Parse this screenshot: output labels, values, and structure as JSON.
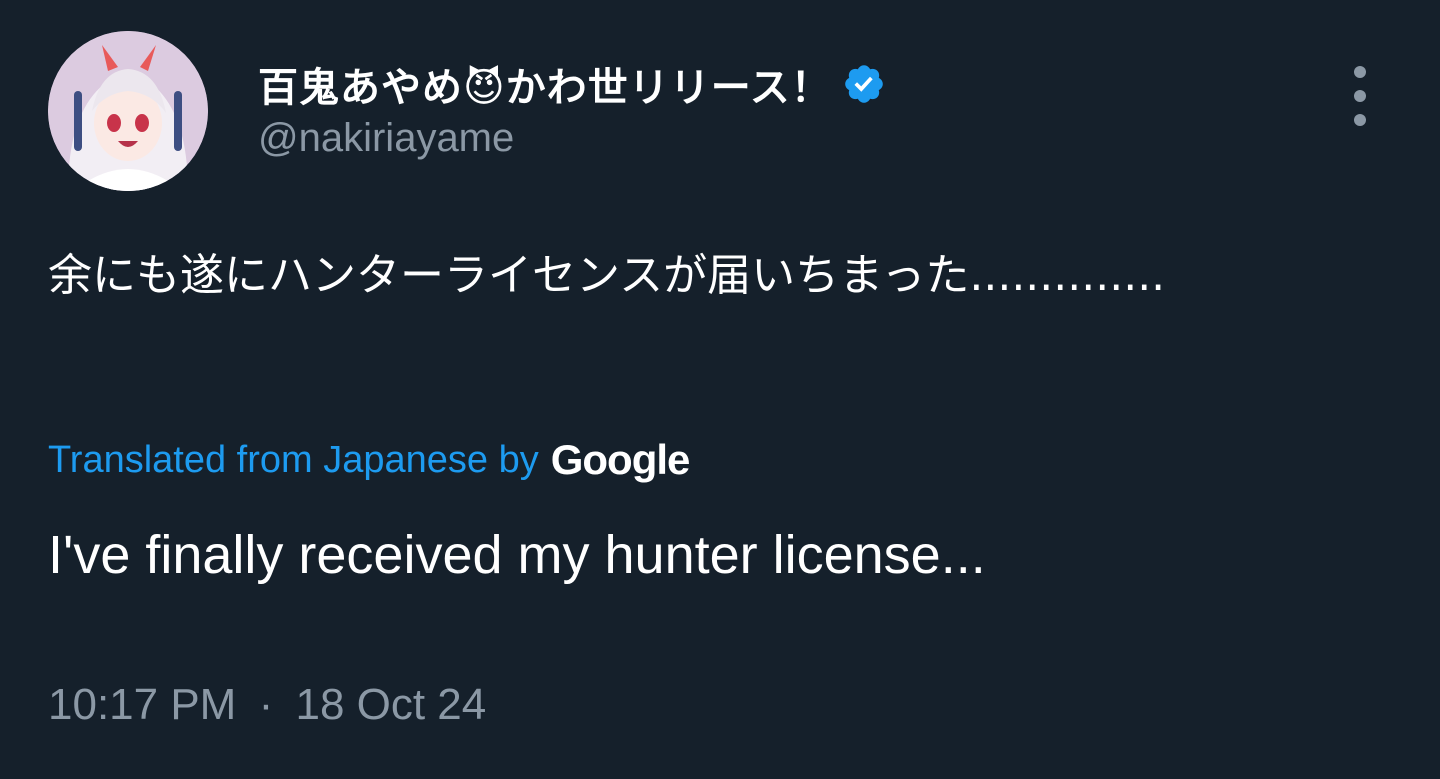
{
  "author": {
    "display_name": "百鬼あやめ😈かわ世リリース！",
    "handle": "@nakiriayame",
    "avatar_icon": "profile-avatar",
    "verified_icon": "verified-badge-icon",
    "verified_color": "#1d9bf0"
  },
  "menu": {
    "icon": "more-options-icon"
  },
  "tweet": {
    "text": "余にも遂にハンターライセンスが届いちまった..............",
    "translation_label": "Translated from Japanese by",
    "translation_provider": "Google",
    "translated_text": "I've finally received my hunter license...",
    "time": "10:17 PM",
    "separator": "·",
    "date": "18 Oct 24"
  },
  "colors": {
    "background": "#15202b",
    "text_primary": "#ffffff",
    "text_secondary": "#8b98a5",
    "link": "#1d9bf0"
  }
}
